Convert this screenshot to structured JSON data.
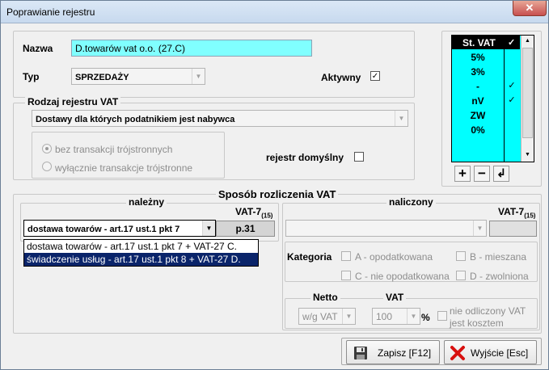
{
  "window": {
    "title": "Poprawianie rejestru",
    "close_label": "✕"
  },
  "nazwa": {
    "label": "Nazwa",
    "value": "D.towarów vat o.o. (27.C)"
  },
  "typ": {
    "label": "Typ",
    "value": "SPRZEDAŻY"
  },
  "aktywny": {
    "label": "Aktywny",
    "checked": "✓"
  },
  "rodzaj": {
    "legend": "Rodzaj rejestru VAT",
    "value": "Dostawy dla których podatnikiem jest nabywca",
    "radio1": "bez transakcji trójstronnych",
    "radio2": "wyłącznie transakcje trójstronne",
    "domyslny_label": "rejestr domyślny"
  },
  "vat_grid": {
    "header": "St. VAT",
    "header_check": "✓",
    "rows": [
      {
        "rate": "5%",
        "check": ""
      },
      {
        "rate": "3%",
        "check": ""
      },
      {
        "rate": "-",
        "check": "✓"
      },
      {
        "rate": "nV",
        "check": "✓"
      },
      {
        "rate": "ZW",
        "check": ""
      },
      {
        "rate": "0%",
        "check": ""
      }
    ]
  },
  "toolbar": {
    "add": "+",
    "remove": "−",
    "undo": "↲"
  },
  "rozliczenie": {
    "legend": "Sposób rozliczenia VAT",
    "nalezny": {
      "legend": "należny",
      "vat7_label": "VAT-7",
      "vat7_sub": "(15)",
      "selected": "dostawa towarów - art.17 ust.1 pkt 7",
      "p_value": "p.31",
      "options": [
        "dostawa towarów - art.17 ust.1 pkt 7   + VAT-27 C.",
        "świadczenie usług - art.17 ust.1 pkt 8   + VAT-27 D."
      ]
    },
    "naliczony": {
      "legend": "naliczony",
      "vat7_label": "VAT-7",
      "vat7_sub": "(15)",
      "kategoria_label": "Kategoria",
      "cat_a": "A - opodatkowana",
      "cat_b": "B - mieszana",
      "cat_c": "C - nie opodatkowana",
      "cat_d": "D - zwolniona",
      "netto_legend": "Netto",
      "vat_legend": "VAT",
      "netto_value": "w/g VAT",
      "vat_value": "100",
      "percent": "%",
      "nie_odliczony": "nie odliczony VAT",
      "jest_kosztem": "jest kosztem"
    }
  },
  "buttons": {
    "save": "Zapisz  [F12]",
    "exit": "Wyjście  [Esc]"
  },
  "colors": {
    "accent_cyan": "#80ffff",
    "grid_cyan": "#00ffff",
    "selection": "#0a246a"
  }
}
